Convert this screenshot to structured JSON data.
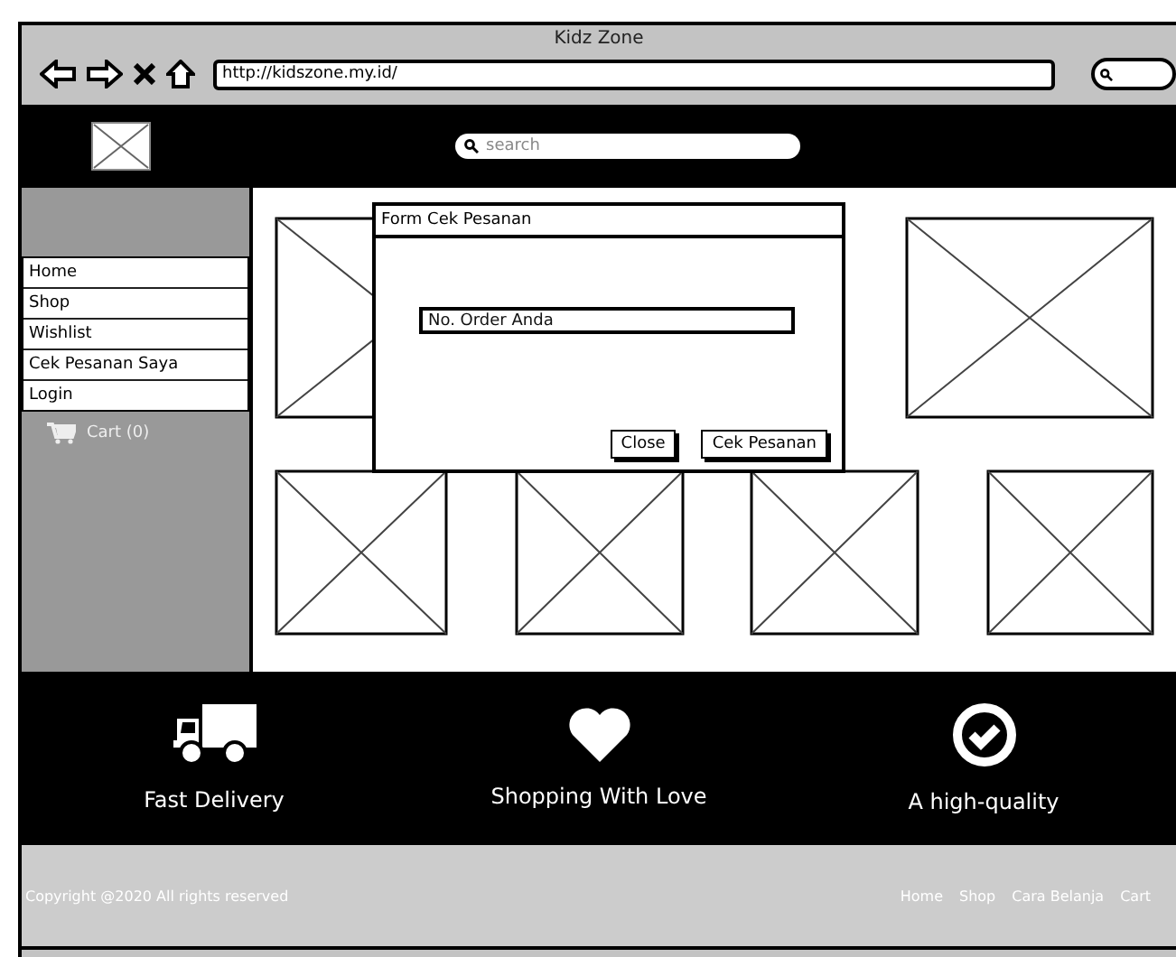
{
  "window": {
    "title": "Kidz Zone",
    "url": "http://kidszone.my.id/"
  },
  "header": {
    "search": {
      "placeholder": "search"
    }
  },
  "sidebar": {
    "items": [
      {
        "label": "Home"
      },
      {
        "label": "Shop"
      },
      {
        "label": "Wishlist"
      },
      {
        "label": "Cek Pesanan Saya"
      },
      {
        "label": "Login"
      }
    ],
    "cart": "Cart (0)"
  },
  "dialog": {
    "title": "Form Cek Pesanan",
    "field": {
      "placeholder": "No. Order Anda"
    },
    "buttons": [
      "Close",
      "Cek Pesanan"
    ]
  },
  "features": [
    {
      "kind": "truck",
      "label": "Fast Delivery"
    },
    {
      "kind": "heart",
      "label": "Shopping With Love"
    },
    {
      "kind": "check",
      "label": "A high-quality"
    }
  ],
  "footer": {
    "copyright": "Copyright @2020 All rights reserved",
    "links": [
      "Home",
      "Shop",
      "Cara Belanja",
      "Cart"
    ]
  }
}
